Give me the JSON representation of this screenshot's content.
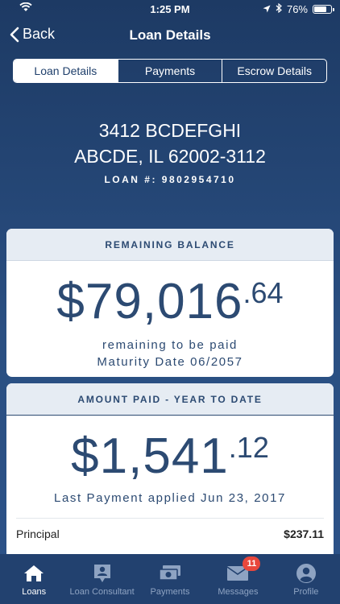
{
  "status_bar": {
    "time": "1:25 PM",
    "battery": "76%",
    "battery_level": 0.76,
    "icons": [
      "wifi-icon",
      "location-icon",
      "bluetooth-icon",
      "battery-icon"
    ]
  },
  "nav": {
    "back_label": "Back",
    "title": "Loan Details"
  },
  "segments": [
    {
      "label": "Loan Details",
      "active": true
    },
    {
      "label": "Payments",
      "active": false
    },
    {
      "label": "Escrow Details",
      "active": false
    }
  ],
  "property": {
    "street": "3412 BCDEFGHI",
    "city_state_zip": "ABCDE, IL 62002-3112",
    "loan_number": "LOAN #: 9802954710"
  },
  "remaining_balance": {
    "header": "REMAINING BALANCE",
    "amount_whole": "$79,016",
    "amount_cents": ".64",
    "line1": "remaining to be paid",
    "line2": "Maturity Date 06/2057"
  },
  "amount_paid": {
    "header": "AMOUNT PAID - YEAR TO DATE",
    "amount_whole": "$1,541",
    "amount_cents": ".12",
    "last_payment": "Last Payment applied Jun 23, 2017",
    "rows": [
      {
        "label": "Principal",
        "value": "$237.11"
      }
    ]
  },
  "tabbar": {
    "items": [
      {
        "label": "Loans",
        "icon": "home-icon",
        "active": true
      },
      {
        "label": "Loan Consultant",
        "icon": "consultant-icon",
        "active": false
      },
      {
        "label": "Payments",
        "icon": "payments-icon",
        "active": false
      },
      {
        "label": "Messages",
        "icon": "mail-icon",
        "active": false,
        "badge": "11"
      },
      {
        "label": "Profile",
        "icon": "profile-icon",
        "active": false
      }
    ]
  },
  "colors": {
    "primary": "#1f3f6b",
    "card_text": "#2c4a72",
    "badge": "#e8473c",
    "tab_inactive": "#8ea3c2"
  }
}
